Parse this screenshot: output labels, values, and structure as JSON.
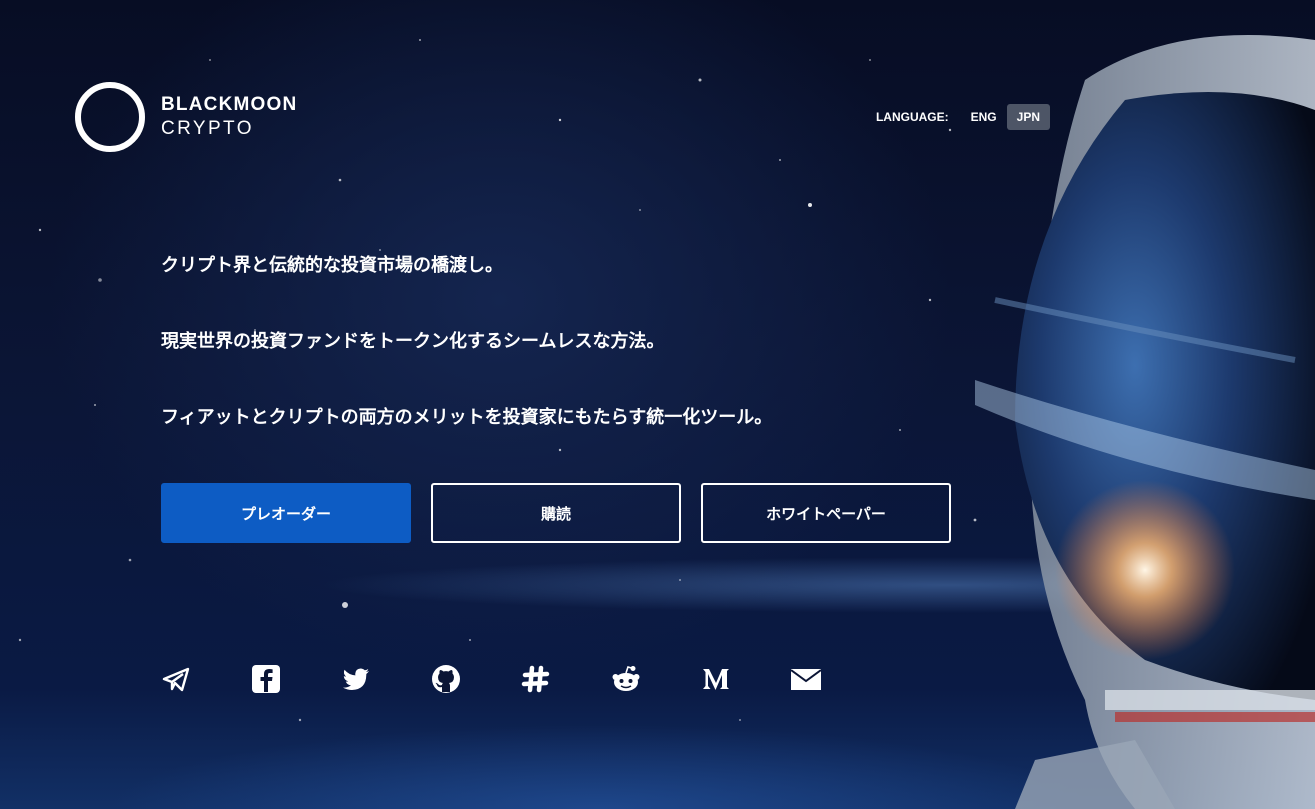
{
  "brand": {
    "line1": "BLACKMOON",
    "line2": "CRYPTO"
  },
  "language": {
    "label": "LANGUAGE:",
    "options": [
      "ENG",
      "JPN"
    ],
    "active": "JPN"
  },
  "taglines": [
    "クリプト界と伝統的な投資市場の橋渡し。",
    "現実世界の投資ファンドをトークン化するシームレスな方法。",
    "フィアットとクリプトの両方のメリットを投資家にもたらす統一化ツール。"
  ],
  "buttons": {
    "preorder": "プレオーダー",
    "subscribe": "購読",
    "whitepaper": "ホワイトペーパー"
  },
  "social_icons": [
    "telegram-icon",
    "facebook-icon",
    "twitter-icon",
    "github-icon",
    "slack-icon",
    "reddit-icon",
    "medium-icon",
    "mail-icon"
  ],
  "colors": {
    "accent": "#0d5cc4",
    "background": "#0b1535",
    "active_lang_bg": "#4d5566"
  }
}
